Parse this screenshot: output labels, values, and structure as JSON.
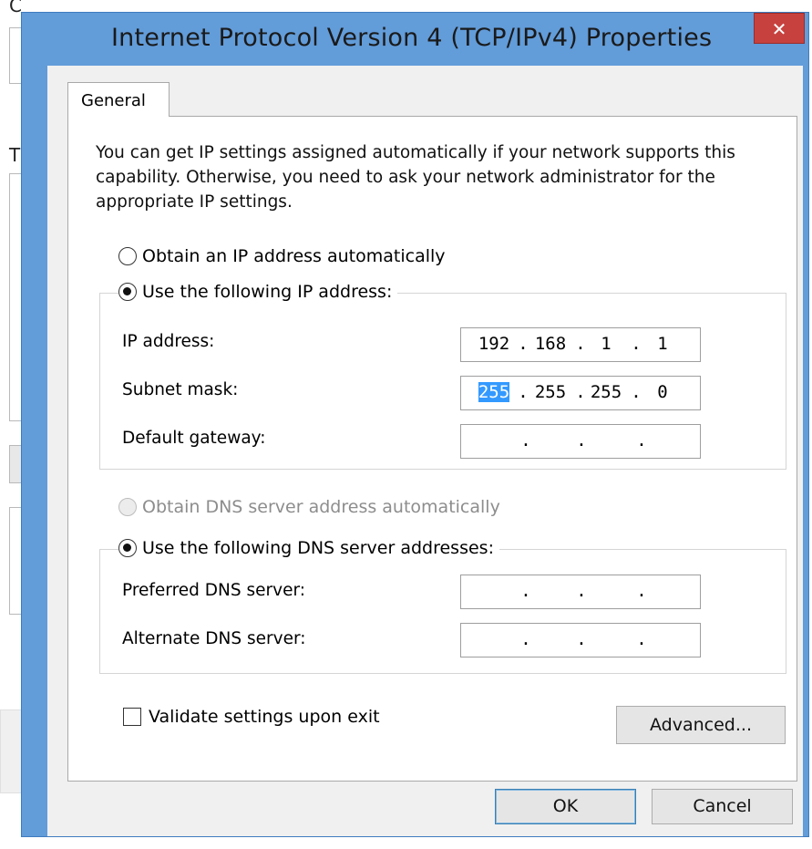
{
  "window": {
    "title": "Internet Protocol Version 4 (TCP/IPv4) Properties",
    "close_glyph": "✕"
  },
  "tabs": [
    {
      "label": "General",
      "selected": true
    }
  ],
  "description": "You can get IP settings assigned automatically if your network supports this capability. Otherwise, you need to ask your network administrator for the appropriate IP settings.",
  "ip_section": {
    "auto_label": "Obtain an IP address automatically",
    "manual_label": "Use the following IP address:",
    "selected": "manual",
    "fields": [
      {
        "label": "IP address:",
        "octets": [
          "192",
          "168",
          "1",
          "1"
        ]
      },
      {
        "label": "Subnet mask:",
        "octets": [
          "255",
          "255",
          "255",
          "0"
        ],
        "selected_octet": 0
      },
      {
        "label": "Default gateway:",
        "octets": [
          "",
          "",
          "",
          ""
        ]
      }
    ]
  },
  "dns_section": {
    "auto_label": "Obtain DNS server address automatically",
    "auto_enabled": false,
    "manual_label": "Use the following DNS server addresses:",
    "selected": "manual",
    "fields": [
      {
        "label": "Preferred DNS server:",
        "octets": [
          "",
          "",
          "",
          ""
        ]
      },
      {
        "label": "Alternate DNS server:",
        "octets": [
          "",
          "",
          "",
          ""
        ]
      }
    ]
  },
  "validate_checkbox": {
    "label": "Validate settings upon exit",
    "checked": false
  },
  "buttons": {
    "advanced": "Advanced...",
    "ok": "OK",
    "cancel": "Cancel"
  },
  "colors": {
    "titlebar": "#629cd9",
    "close_button": "#c7423f",
    "selection": "#3399ff"
  },
  "background_window": {
    "fragment_1": "C",
    "fragment_2": "T"
  }
}
